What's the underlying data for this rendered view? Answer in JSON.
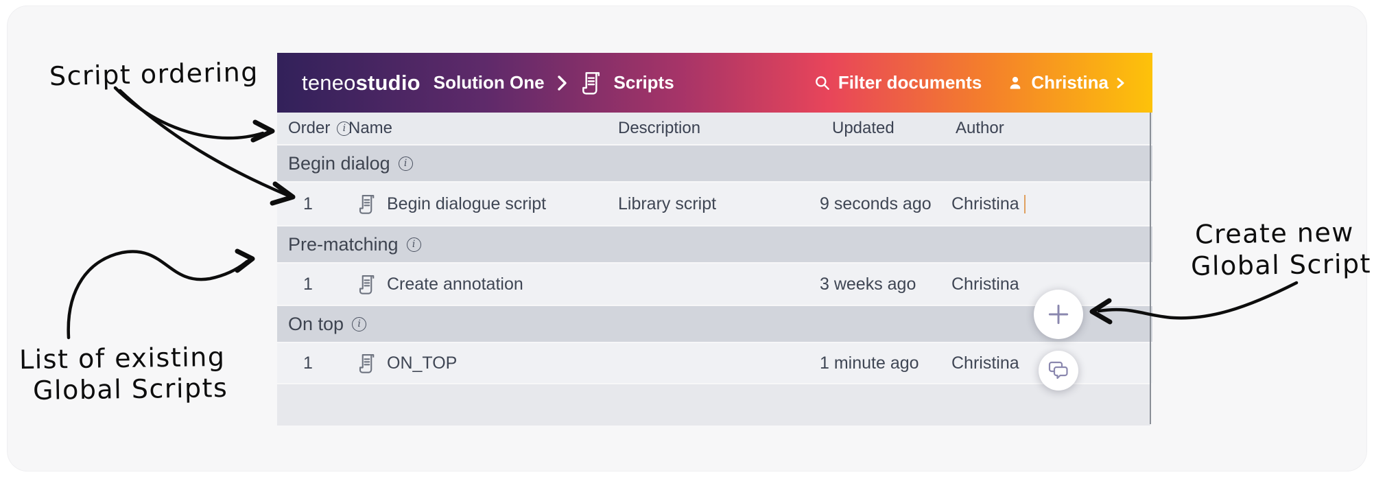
{
  "header": {
    "logo_teneo": "teneo",
    "logo_studio": "studio",
    "breadcrumb_solution": "Solution One",
    "breadcrumb_page": "Scripts",
    "filter_label": "Filter documents",
    "user_name": "Christina"
  },
  "table": {
    "columns": {
      "order": "Order",
      "name": "Name",
      "description": "Description",
      "updated": "Updated",
      "author": "Author"
    },
    "sections": [
      {
        "title": "Begin dialog",
        "rows": [
          {
            "order": "1",
            "name": "Begin dialogue script",
            "description": "Library script",
            "updated": "9 seconds ago",
            "author": "Christina"
          }
        ]
      },
      {
        "title": "Pre-matching",
        "rows": [
          {
            "order": "1",
            "name": "Create annotation",
            "description": "",
            "updated": "3 weeks ago",
            "author": "Christina"
          }
        ]
      },
      {
        "title": "On top",
        "rows": [
          {
            "order": "1",
            "name": "ON_TOP",
            "description": "",
            "updated": "1 minute ago",
            "author": "Christina"
          }
        ]
      }
    ]
  },
  "annotations": {
    "script_ordering": "Script ordering",
    "list_existing_line1": "List of existing",
    "list_existing_line2": "Global Scripts",
    "create_new_line1": "Create new",
    "create_new_line2": "Global Script"
  },
  "icons": {
    "info_glyph": "i"
  },
  "colors": {
    "gradient_start": "#32215a",
    "gradient_purple": "#5f2a6a",
    "gradient_magenta": "#a63468",
    "gradient_red": "#e8455a",
    "gradient_orange": "#f47f2b",
    "gradient_yellow": "#fdc20a",
    "section_bg": "#d2d5dc",
    "row_bg": "#f0f1f4",
    "fab_icon": "#8a87ae",
    "text_cursor": "#dfa05f"
  }
}
